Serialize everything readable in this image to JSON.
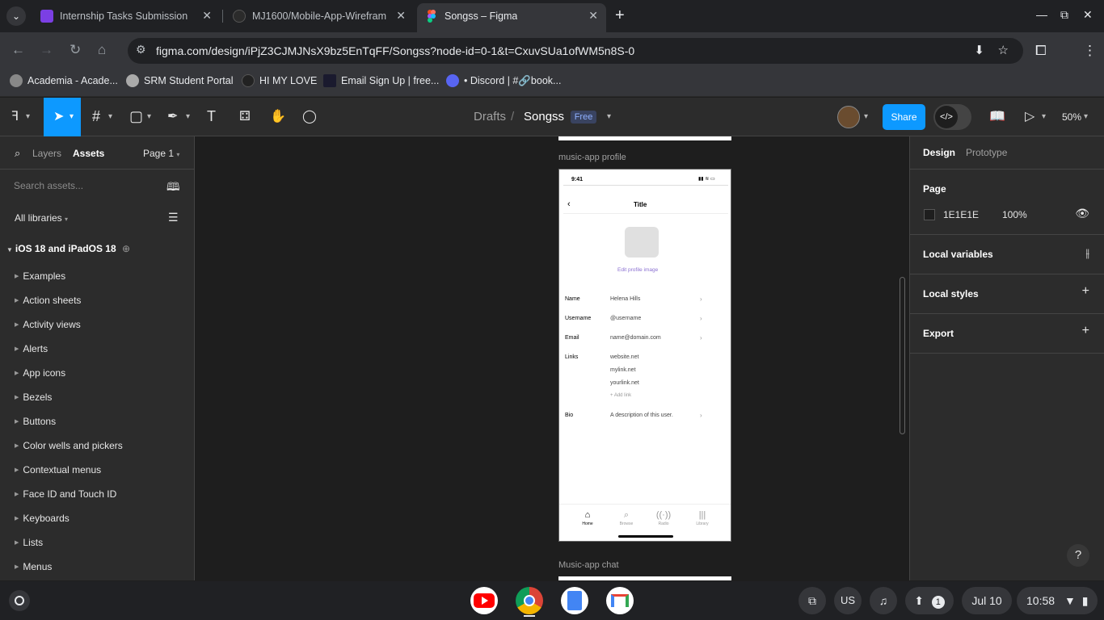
{
  "browser": {
    "tabs": [
      {
        "title": "Internship Tasks Submission",
        "favicon_color": "#7b3fe4"
      },
      {
        "title": "MJ1600/Mobile-App-Wirefram",
        "favicon_color": "#24292e"
      },
      {
        "title": "Songss – Figma",
        "favicon_color": "#f24e1e",
        "active": true
      }
    ],
    "url": "figma.com/design/iPjZ3CJMJNsX9bz5EnTqFF/Songss?node-id=0-1&t=CxuvSUa1ofWM5n8S-0",
    "bookmarks": [
      {
        "label": "Academia - Acade...",
        "icon_color": "#888"
      },
      {
        "label": "SRM Student Portal",
        "icon_color": "#aaa"
      },
      {
        "label": "HI MY LOVE",
        "icon_color": "#222"
      },
      {
        "label": "Email Sign Up | free...",
        "icon_color": "#1a1a2e"
      },
      {
        "label": "• Discord | #🔗book...",
        "icon_color": "#5865f2"
      }
    ]
  },
  "figma": {
    "breadcrumb_drafts": "Drafts",
    "breadcrumb_sep": "/",
    "file_name": "Songss",
    "plan_badge": "Free",
    "share_label": "Share",
    "zoom": "50%",
    "accent": "#0d99ff",
    "left_panel": {
      "tab_layers": "Layers",
      "tab_assets": "Assets",
      "page_select": "Page 1",
      "search_placeholder": "Search assets...",
      "libraries": "All libraries",
      "section": "iOS 18 and iPadOS 18",
      "items": [
        "Examples",
        "Action sheets",
        "Activity views",
        "Alerts",
        "App icons",
        "Bezels",
        "Buttons",
        "Color wells and pickers",
        "Contextual menus",
        "Face ID and Touch ID",
        "Keyboards",
        "Lists",
        "Menus"
      ]
    },
    "canvas": {
      "frame1_label": "music-app profile",
      "frame2_label": "Music-app chat",
      "phone": {
        "time": "9:41",
        "title": "Title",
        "edit_image": "Edit profile image",
        "rows": [
          {
            "label": "Name",
            "value": "Helena Hills",
            "chevron": true
          },
          {
            "label": "Username",
            "value": "@username",
            "chevron": true
          },
          {
            "label": "Email",
            "value": "name@domain.com",
            "chevron": true
          }
        ],
        "links_label": "Links",
        "links": [
          "website.net",
          "mylink.net",
          "yourlink.net"
        ],
        "add_link": "+ Add link",
        "bio_label": "Bio",
        "bio_value": "A description of this user.",
        "tabbar": [
          "Home",
          "Browse",
          "Radio",
          "Library"
        ]
      }
    },
    "right_panel": {
      "tab_design": "Design",
      "tab_prototype": "Prototype",
      "page_heading": "Page",
      "page_color": "1E1E1E",
      "page_opacity": "100%",
      "local_variables": "Local variables",
      "local_styles": "Local styles",
      "export": "Export"
    }
  },
  "shelf": {
    "ime": "US",
    "notifications": "1",
    "date": "Jul 10",
    "time": "10:58"
  }
}
